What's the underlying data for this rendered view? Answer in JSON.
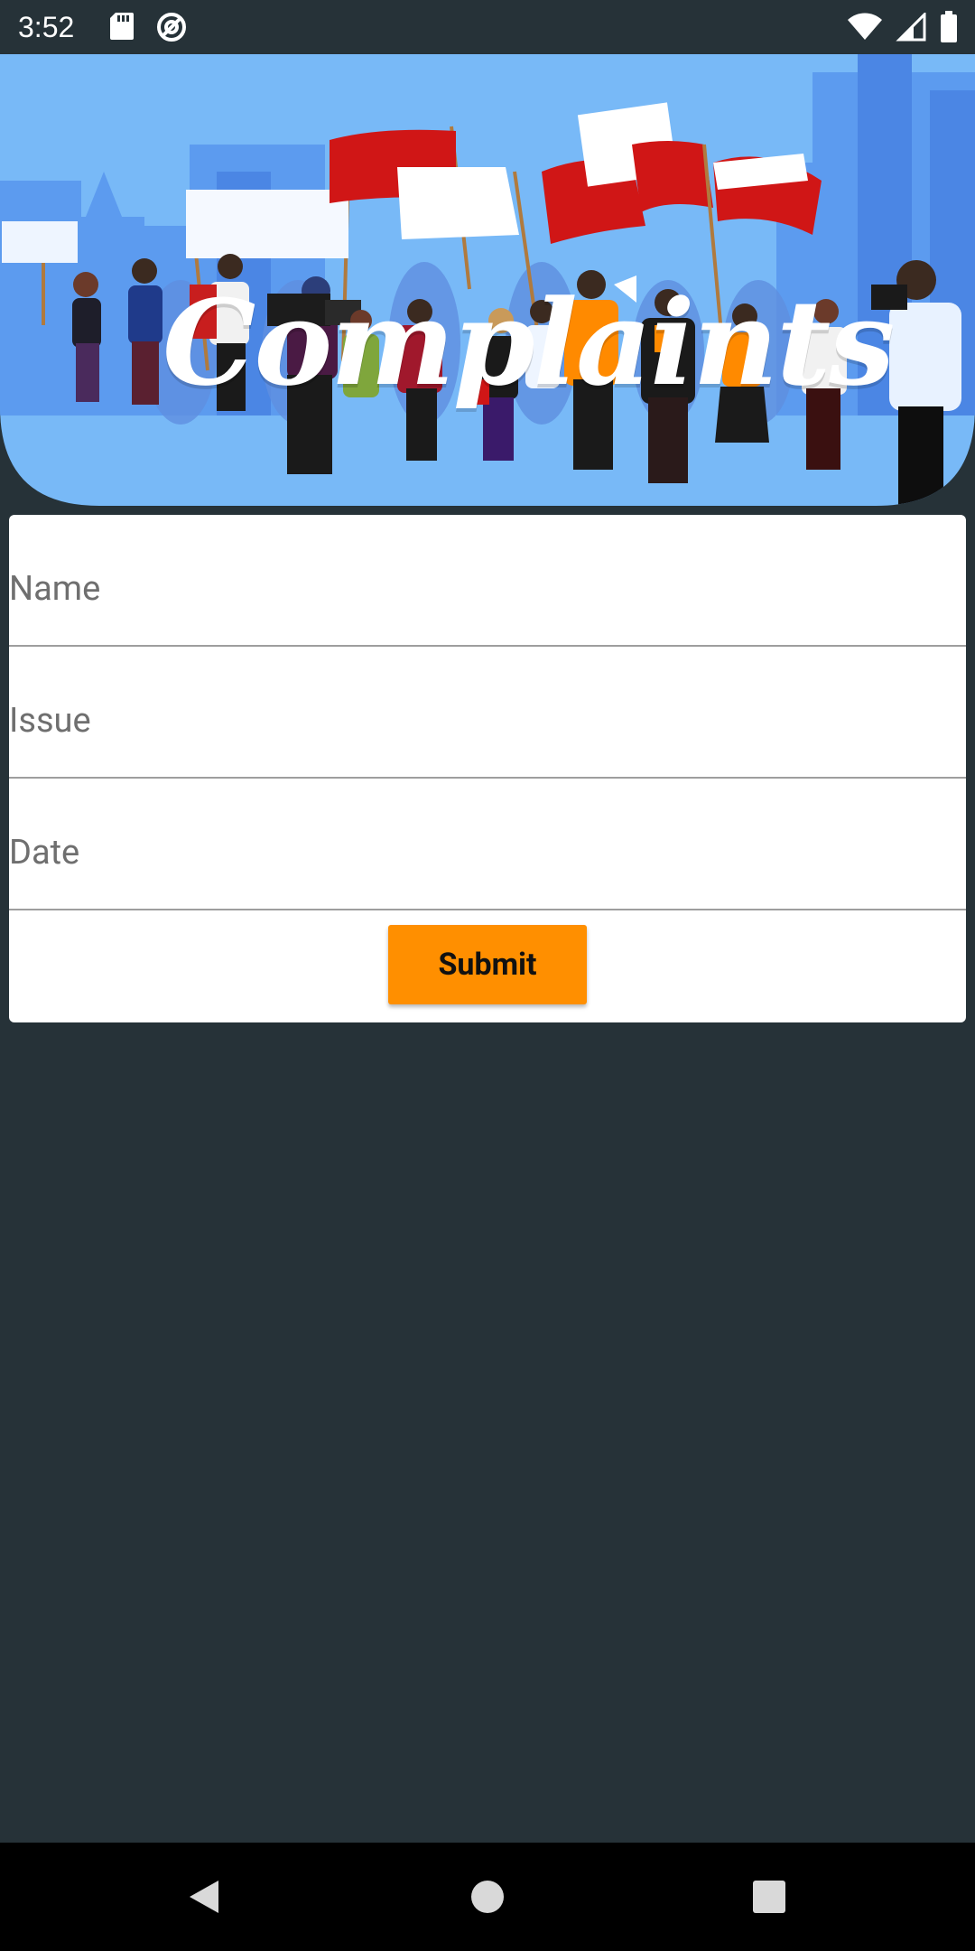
{
  "status_bar": {
    "time": "3:52",
    "icons": [
      "sd-card-icon",
      "data-saver-icon",
      "wifi-icon",
      "signal-icon",
      "battery-icon"
    ]
  },
  "banner": {
    "title": "Complaints"
  },
  "form": {
    "fields": [
      {
        "placeholder": "Name",
        "value": ""
      },
      {
        "placeholder": "Issue",
        "value": ""
      },
      {
        "placeholder": "Date",
        "value": ""
      }
    ],
    "submit_label": "Submit"
  },
  "colors": {
    "background": "#263238",
    "banner_sky": "#78b9f7",
    "accent": "#ff8f00",
    "card": "#ffffff"
  },
  "nav_bar": {
    "buttons": [
      "back-icon",
      "home-icon",
      "recents-icon"
    ]
  }
}
